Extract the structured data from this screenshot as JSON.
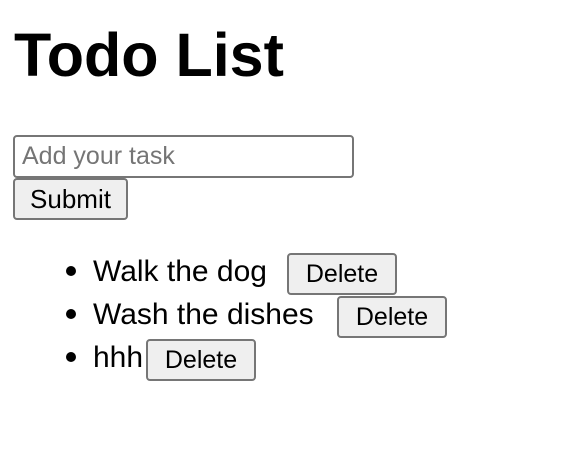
{
  "header": {
    "title": "Todo List"
  },
  "form": {
    "input_value": "",
    "input_placeholder": "Add your task",
    "submit_label": "Submit"
  },
  "tasks": [
    {
      "text": "Walk the dog",
      "delete_label": "Delete"
    },
    {
      "text": "Wash the dishes",
      "delete_label": "Delete"
    },
    {
      "text": "hhh",
      "delete_label": "Delete"
    }
  ]
}
